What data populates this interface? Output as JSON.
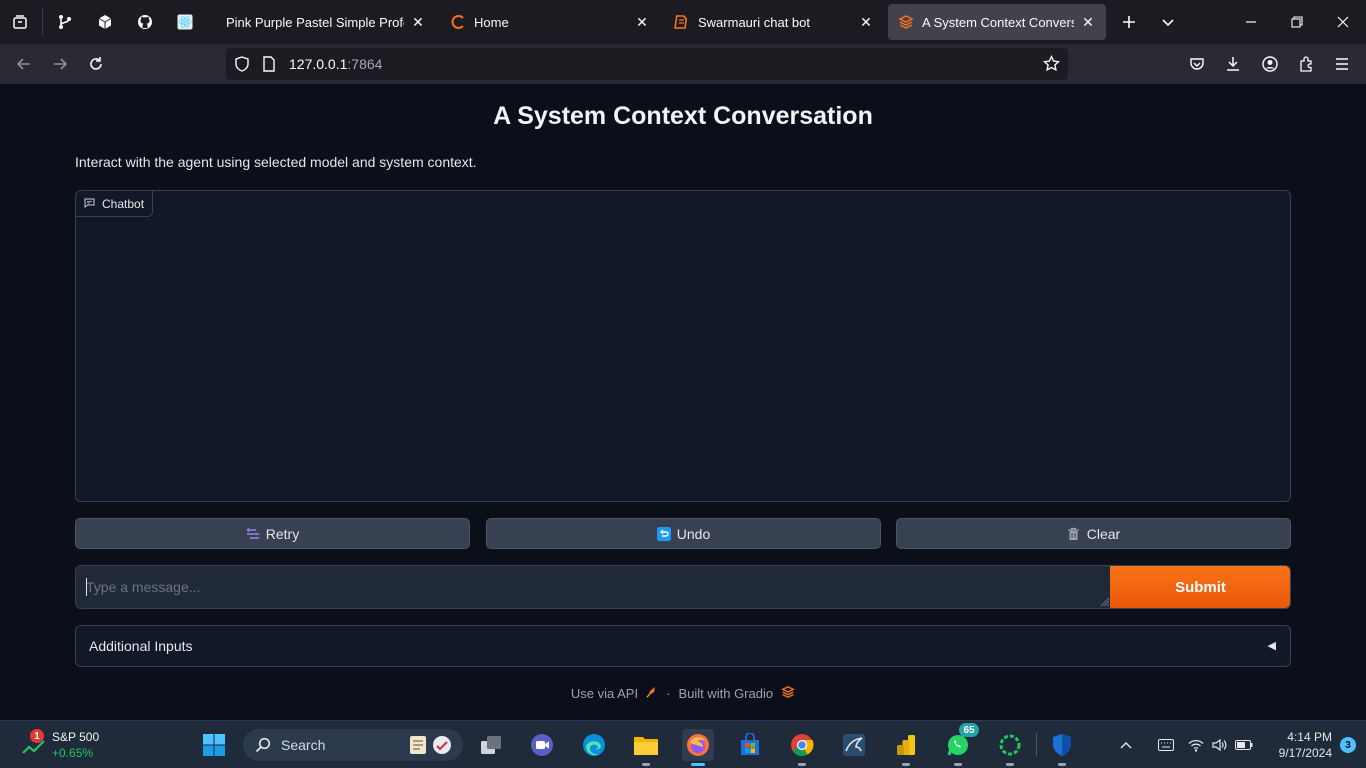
{
  "browser": {
    "tabs": [
      {
        "title": "Pink Purple Pastel Simple Professional",
        "favicon": "pink-page-favicon"
      },
      {
        "title": "Home",
        "favicon": "orange-ring-favicon"
      },
      {
        "title": "Swarmauri chat bot",
        "favicon": "orange-book-favicon"
      },
      {
        "title": "A System Context Conversation",
        "favicon": "gradio-favicon"
      }
    ],
    "url_host": "127.0.0.1",
    "url_port": ":7864"
  },
  "page": {
    "title": "A System Context Conversation",
    "description": "Interact with the agent using selected model and system context.",
    "chatbot_label": "Chatbot",
    "buttons": {
      "retry": "Retry",
      "undo": "Undo",
      "clear": "Clear"
    },
    "message_placeholder": "Type a message...",
    "submit_label": "Submit",
    "accordion_label": "Additional Inputs",
    "footer": {
      "api": "Use via API",
      "separator": "·",
      "built_with": "Built with Gradio"
    },
    "accent_color": "#f97316"
  },
  "taskbar": {
    "widget": {
      "name": "S&P 500",
      "change": "+0.65%",
      "badge": "1"
    },
    "search_label": "Search",
    "whatsapp_badge": "65",
    "clock": {
      "time": "4:14 PM",
      "date": "9/17/2024"
    },
    "notification_count": "3"
  }
}
